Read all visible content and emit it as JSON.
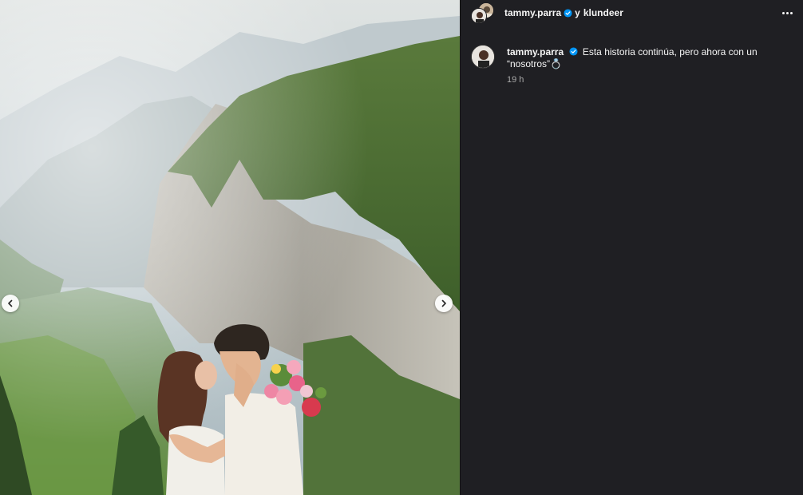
{
  "post": {
    "header": {
      "username": "tammy.parra",
      "separator": "y",
      "collaborator": "klundeer",
      "more_label": "More options"
    },
    "caption": {
      "username": "tammy.parra",
      "text": "Esta historia continúa, pero ahora con un “nosotros”💍",
      "time_ago": "19 h"
    },
    "carousel": {
      "prev_label": "Go back",
      "next_label": "Next"
    }
  },
  "colors": {
    "panel_bg": "#1f1f23",
    "verified_blue": "#0095f6",
    "text_primary": "#f5f5f5",
    "text_secondary": "#a8a8a8"
  },
  "icons": [
    "verified-badge-icon",
    "more-options-icon",
    "chevron-left-icon",
    "chevron-right-icon"
  ]
}
